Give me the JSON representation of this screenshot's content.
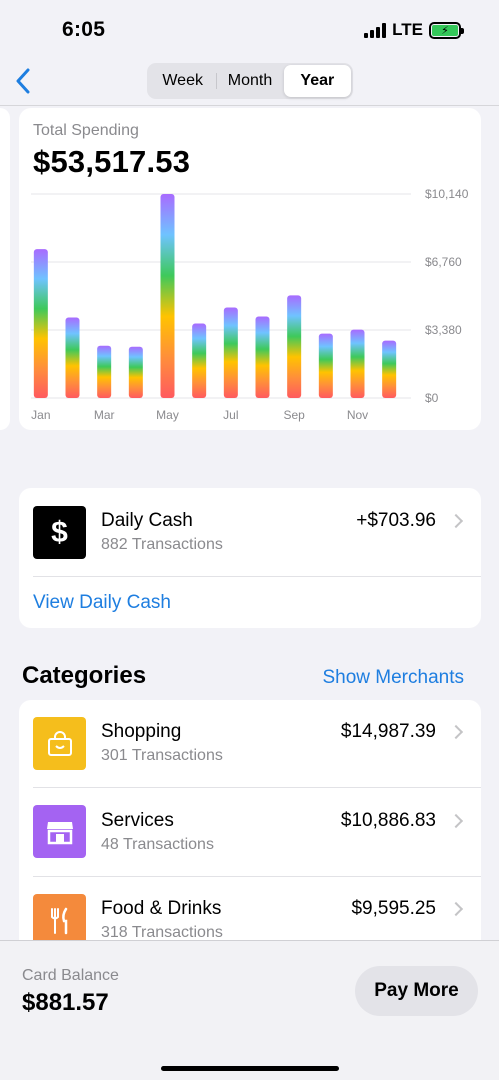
{
  "status_bar": {
    "time": "6:05",
    "network": "LTE"
  },
  "nav": {
    "segments": [
      "Week",
      "Month",
      "Year"
    ],
    "selected": "Year"
  },
  "spending": {
    "label": "Total Spending",
    "value": "$53,517.53"
  },
  "chart_data": {
    "type": "bar",
    "categories": [
      "Jan",
      "Feb",
      "Mar",
      "Apr",
      "May",
      "Jun",
      "Jul",
      "Aug",
      "Sep",
      "Oct",
      "Nov",
      "Dec"
    ],
    "x_tick_labels": [
      "Jan",
      "Mar",
      "May",
      "Jul",
      "Sep",
      "Nov"
    ],
    "values": [
      7400,
      4000,
      2600,
      2550,
      10140,
      3700,
      4500,
      4050,
      5100,
      3200,
      3400,
      2850
    ],
    "y_ticks": [
      "$10,140",
      "$6,760",
      "$3,380",
      "$0"
    ],
    "y_tick_values": [
      10140,
      6760,
      3380,
      0
    ],
    "ylim": [
      0,
      10140
    ],
    "grid": true,
    "colors": {
      "gradient": [
        "#a86bff",
        "#6fc3ff",
        "#3ec95b",
        "#ffc300",
        "#ff8f3a",
        "#ff5a5f"
      ],
      "gridline": "#e6e6e9",
      "tick_text": "#8a8a8e"
    }
  },
  "daily_cash": {
    "title": "Daily Cash",
    "subtitle": "882 Transactions",
    "amount": "+$703.96",
    "link": "View Daily Cash",
    "icon": "dollar-icon"
  },
  "categories": {
    "title": "Categories",
    "action": "Show Merchants",
    "items": [
      {
        "name": "Shopping",
        "transactions": "301 Transactions",
        "amount": "$14,987.39",
        "icon": "shopping-bag-icon",
        "color": "#f5be1c"
      },
      {
        "name": "Services",
        "transactions": "48 Transactions",
        "amount": "$10,886.83",
        "icon": "storefront-icon",
        "color": "#a463f2"
      },
      {
        "name": "Food & Drinks",
        "transactions": "318 Transactions",
        "amount": "$9,595.25",
        "icon": "fork-knife-icon",
        "color": "#f48a3c"
      }
    ]
  },
  "card_balance": {
    "label": "Card Balance",
    "value": "$881.57",
    "button": "Pay More"
  },
  "colors": {
    "accent": "#1e7ee0",
    "background": "#f2f2f7"
  }
}
